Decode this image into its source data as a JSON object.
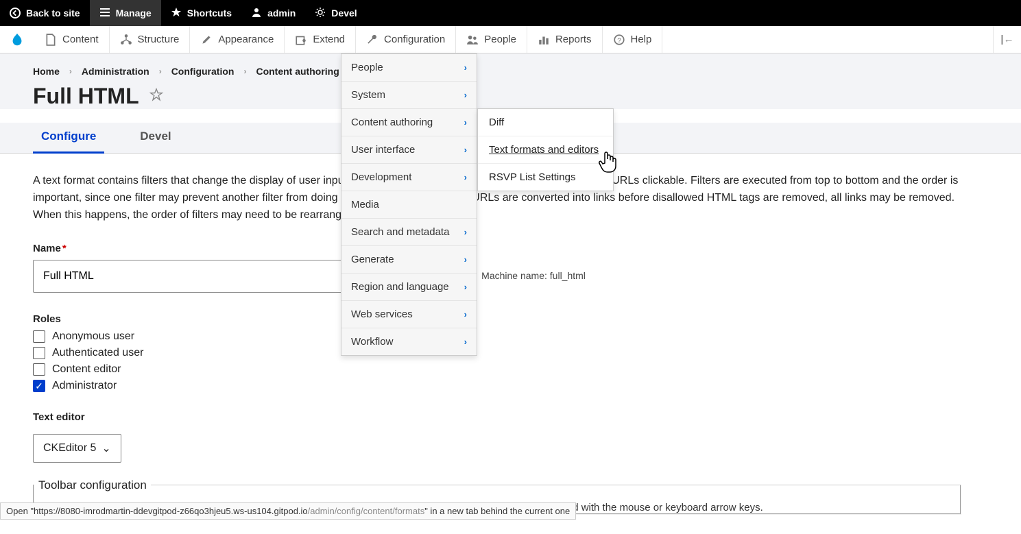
{
  "topbar": {
    "back": "Back to site",
    "manage": "Manage",
    "shortcuts": "Shortcuts",
    "admin": "admin",
    "devel": "Devel"
  },
  "adminmenu": {
    "content": "Content",
    "structure": "Structure",
    "appearance": "Appearance",
    "extend": "Extend",
    "configuration": "Configuration",
    "people": "People",
    "reports": "Reports",
    "help": "Help"
  },
  "breadcrumbs": [
    "Home",
    "Administration",
    "Configuration",
    "Content authoring"
  ],
  "page": {
    "title": "Full HTML",
    "tabs": {
      "configure": "Configure",
      "devel": "Devel"
    },
    "description": "A text format contains filters that change the display of user input; for example, stripping out malicious HTML or making URLs clickable. Filters are executed from top to bottom and the order is important, since one filter may prevent another filter from doing its job. For example, when URLs are converted into links before disallowed HTML tags are removed, all links may be removed. When this happens, the order of filters may need to be rearranged."
  },
  "form": {
    "name_label": "Name",
    "name_value": "Full HTML",
    "machine_name_label": "Machine name: full_html",
    "roles_label": "Roles",
    "roles": [
      "Anonymous user",
      "Authenticated user",
      "Content editor",
      "Administrator"
    ],
    "roles_checked": [
      false,
      false,
      false,
      true
    ],
    "editor_label": "Text editor",
    "editor_value": "CKEditor 5",
    "toolbar_legend": "Toolbar configuration",
    "toolbar_desc": "Move a button into the Active toolbar to enable it, or into the list of Available buttons to disable it. Buttons may be moved with the mouse or keyboard arrow keys."
  },
  "dropdown": {
    "items": [
      "People",
      "System",
      "Content authoring",
      "User interface",
      "Development",
      "Media",
      "Search and metadata",
      "Generate",
      "Region and language",
      "Web services",
      "Workflow"
    ]
  },
  "submenu": {
    "items": [
      "Diff",
      "Text formats and editors",
      "RSVP List Settings"
    ]
  },
  "status_tip": {
    "prefix": "Open \"https://8080-imrodmartin-ddevgitpod-z66qo3hjeu5.ws-us104.gitpod.io",
    "path": "/admin/config/content/formats",
    "suffix": "\" in a new tab behind the current one"
  }
}
